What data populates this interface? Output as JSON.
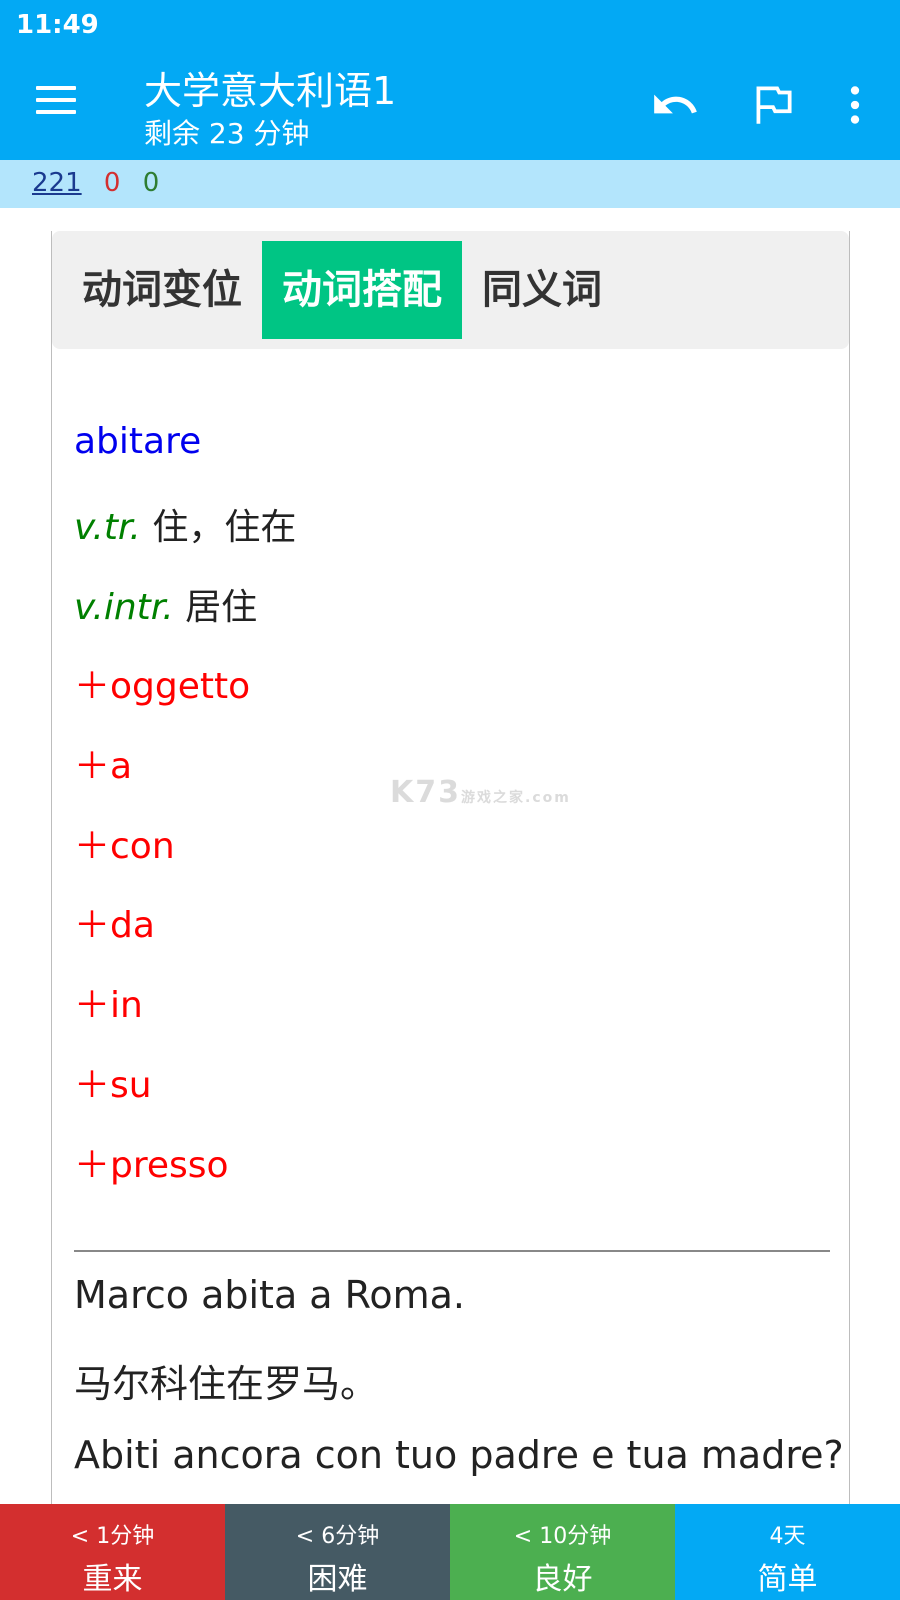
{
  "status_bar": {
    "time": "11:49"
  },
  "app_bar": {
    "title": "大学意大利语1",
    "subtitle": "剩余 23 分钟"
  },
  "counts": {
    "new": "221",
    "learning": "0",
    "review": "0"
  },
  "tabs": [
    {
      "label": "动词变位",
      "active": false
    },
    {
      "label": "动词搭配",
      "active": true
    },
    {
      "label": "同义词",
      "active": false
    }
  ],
  "card": {
    "word": "abitare",
    "definitions": [
      {
        "pos": "v.tr.",
        "meaning": "住，住在"
      },
      {
        "pos": "v.intr.",
        "meaning": "居住"
      }
    ],
    "collocations": [
      "＋oggetto",
      "＋a",
      "＋con",
      "＋da",
      "＋in",
      "＋su",
      "＋presso"
    ],
    "examples": [
      "Marco abita a Roma.",
      "马尔科住在罗马。",
      "Abiti ancora con tuo padre e tua madre?"
    ]
  },
  "watermark": {
    "main": "K73",
    "sub": "游戏之家",
    "domain": ".com"
  },
  "answer_buttons": [
    {
      "time": "< 1分钟",
      "label": "重来"
    },
    {
      "time": "< 6分钟",
      "label": "困难"
    },
    {
      "time": "< 10分钟",
      "label": "良好"
    },
    {
      "time": "4天",
      "label": "简单"
    }
  ],
  "colors": {
    "app_bar": "#03a9f4",
    "active_tab": "#00c584",
    "again": "#d32f2f",
    "hard": "#455a64",
    "good": "#4caf50",
    "easy": "#03a9f4",
    "word": "#0000ee",
    "pos": "#008000",
    "collocation": "#ff0000"
  }
}
